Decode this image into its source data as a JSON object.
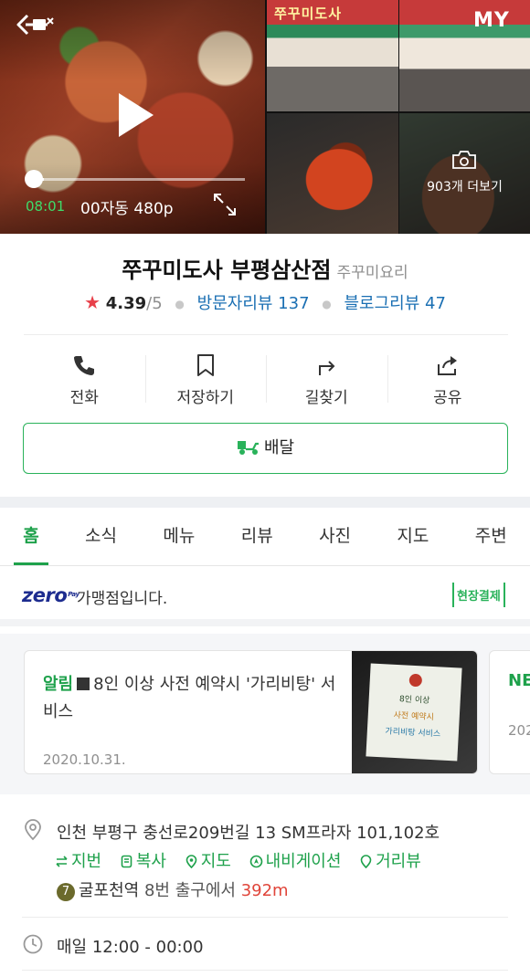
{
  "media": {
    "video": {
      "current_time": "08:01",
      "quality": "00자동 480p",
      "progress": 0.05
    },
    "store_sign": "쭈꾸미도사",
    "more_photos": "903개 더보기",
    "my_label": "MY"
  },
  "place": {
    "name": "쭈꾸미도사 부평삼산점",
    "category": "주꾸미요리",
    "rating": "4.39",
    "rating_max": "/5",
    "visitor_reviews": "방문자리뷰 137",
    "blog_reviews": "블로그리뷰 47"
  },
  "actions": [
    {
      "label": "전화",
      "icon": "phone-icon"
    },
    {
      "label": "저장하기",
      "icon": "bookmark-icon"
    },
    {
      "label": "길찾기",
      "icon": "directions-icon"
    },
    {
      "label": "공유",
      "icon": "share-icon"
    }
  ],
  "delivery": {
    "label": "배달",
    "icon": "delivery-scooter-icon"
  },
  "tabs": [
    {
      "label": "홈",
      "active": true
    },
    {
      "label": "소식"
    },
    {
      "label": "메뉴"
    },
    {
      "label": "리뷰"
    },
    {
      "label": "사진"
    },
    {
      "label": "지도"
    },
    {
      "label": "주변"
    }
  ],
  "zero_pay": {
    "logo": "zero",
    "logo_sub": "Pay",
    "text": "가맹점입니다.",
    "badge": "현장결제"
  },
  "notices": [
    {
      "tag": "알림",
      "text": "8인 이상 사전 예약시 '가리비탕' 서비스",
      "date": "2020.10.31.",
      "thumb_lines": [
        "8인 이상",
        "사전 예약시",
        "가리비탕 서비스"
      ]
    },
    {
      "tag": "NE",
      "date": "202"
    }
  ],
  "address": {
    "full": "인천 부평구 충선로209번길 13 SM프라자 101,102호",
    "links": [
      {
        "label": "지번",
        "icon": "swap-icon"
      },
      {
        "label": "복사",
        "icon": "copy-icon"
      },
      {
        "label": "지도",
        "icon": "map-pin-icon"
      },
      {
        "label": "내비게이션",
        "icon": "navigation-icon"
      },
      {
        "label": "거리뷰",
        "icon": "street-view-icon"
      }
    ],
    "subway_line": "7",
    "station": "굴포천역",
    "exit": "8번 출구에서",
    "distance": "392m"
  },
  "hours": "매일 12:00 - 00:00",
  "colors": {
    "accent_green": "#1ea14b",
    "link_blue": "#1a6fb3",
    "star_red": "#e8404a",
    "distance_red": "#e0453a",
    "zero_navy": "#1d2c8f"
  }
}
